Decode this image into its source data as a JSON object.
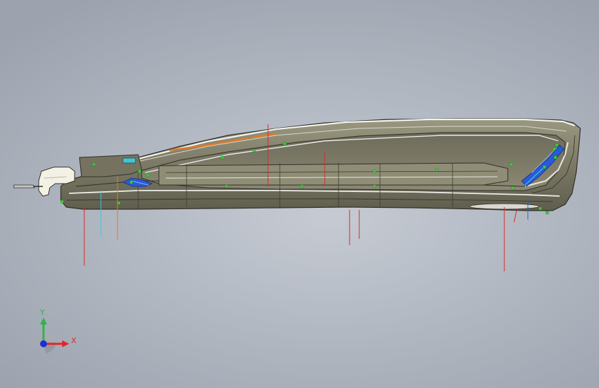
{
  "viewport": {
    "background_top": "#9aa1ad",
    "background_center": "#c6cbd3"
  },
  "triad": {
    "y_label": "Y",
    "x_label": "X",
    "y_color": "#2fb34a",
    "x_color": "#e0262b",
    "z_color": "#1f2fd6"
  },
  "model": {
    "body_color": "#7f7d69",
    "edge_color": "#2f2f28",
    "highlight_color": "#f2f2f0",
    "accent_orange": "#e07a2a",
    "accent_blue": "#2a5ad8",
    "accent_cyan": "#3fc6d8",
    "marker_green": "#3ad23a",
    "dimension_red": "#d62a2a"
  }
}
